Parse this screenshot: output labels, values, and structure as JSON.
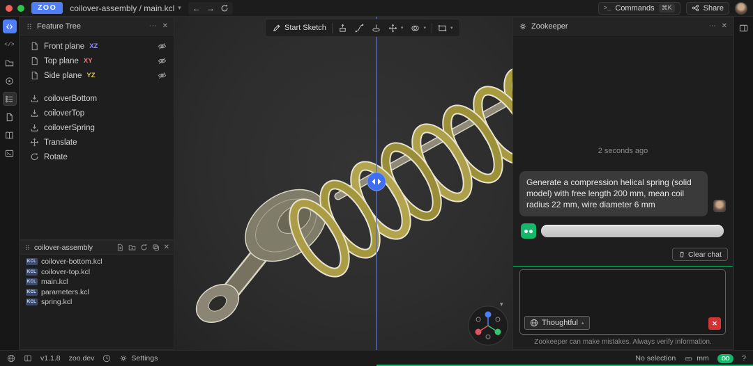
{
  "titlebar": {
    "logo": "ZOO",
    "breadcrumb": "coilover-assembly / main.kcl",
    "commands_label": "Commands",
    "commands_shortcut": "⌘K",
    "share_label": "Share"
  },
  "icons": {
    "back": "←",
    "forward": "→",
    "ellipsis": "⋯",
    "close": "✕",
    "chevron_down": "▾",
    "chevron_up": "▴",
    "code": "</>",
    "prompt": ">_"
  },
  "feature_tree": {
    "title": "Feature Tree",
    "planes": [
      {
        "label": "Front plane",
        "axis": "XZ"
      },
      {
        "label": "Top plane",
        "axis": "XY"
      },
      {
        "label": "Side plane",
        "axis": "YZ"
      }
    ],
    "operations": [
      {
        "label": "coiloverBottom"
      },
      {
        "label": "coiloverTop"
      },
      {
        "label": "coiloverSpring"
      },
      {
        "label": "Translate"
      },
      {
        "label": "Rotate"
      }
    ]
  },
  "project_panel": {
    "title": "coilover-assembly",
    "badge": "KCL",
    "files": [
      "coilover-bottom.kcl",
      "coilover-top.kcl",
      "main.kcl",
      "parameters.kcl",
      "spring.kcl"
    ]
  },
  "viewport_toolbar": {
    "start_sketch": "Start Sketch"
  },
  "zookeeper": {
    "title": "Zookeeper",
    "timestamp": "2 seconds ago",
    "user_message": "Generate a compression helical spring (solid model) with free length 200 mm, mean coil radius 22 mm, wire diameter 6 mm",
    "clear_chat": "Clear chat",
    "model_selector": "Thoughtful",
    "disclaimer": "Zookeeper can make mistakes. Always verify information."
  },
  "statusbar": {
    "version": "v1.1.8",
    "site": "zoo.dev",
    "settings_label": "Settings",
    "selection": "No selection",
    "units": "mm",
    "zoo_badge": "OO",
    "help": "?"
  },
  "colors": {
    "accent_blue": "#4f7ef8",
    "zoo_green": "#14b86b",
    "stream_green": "#18b56f",
    "axis_xz": "#8f8ff7",
    "axis_xy": "#f07878",
    "axis_yz": "#dcc84f",
    "red_btn": "#d23333",
    "spring_olive": "#a89b3f"
  }
}
